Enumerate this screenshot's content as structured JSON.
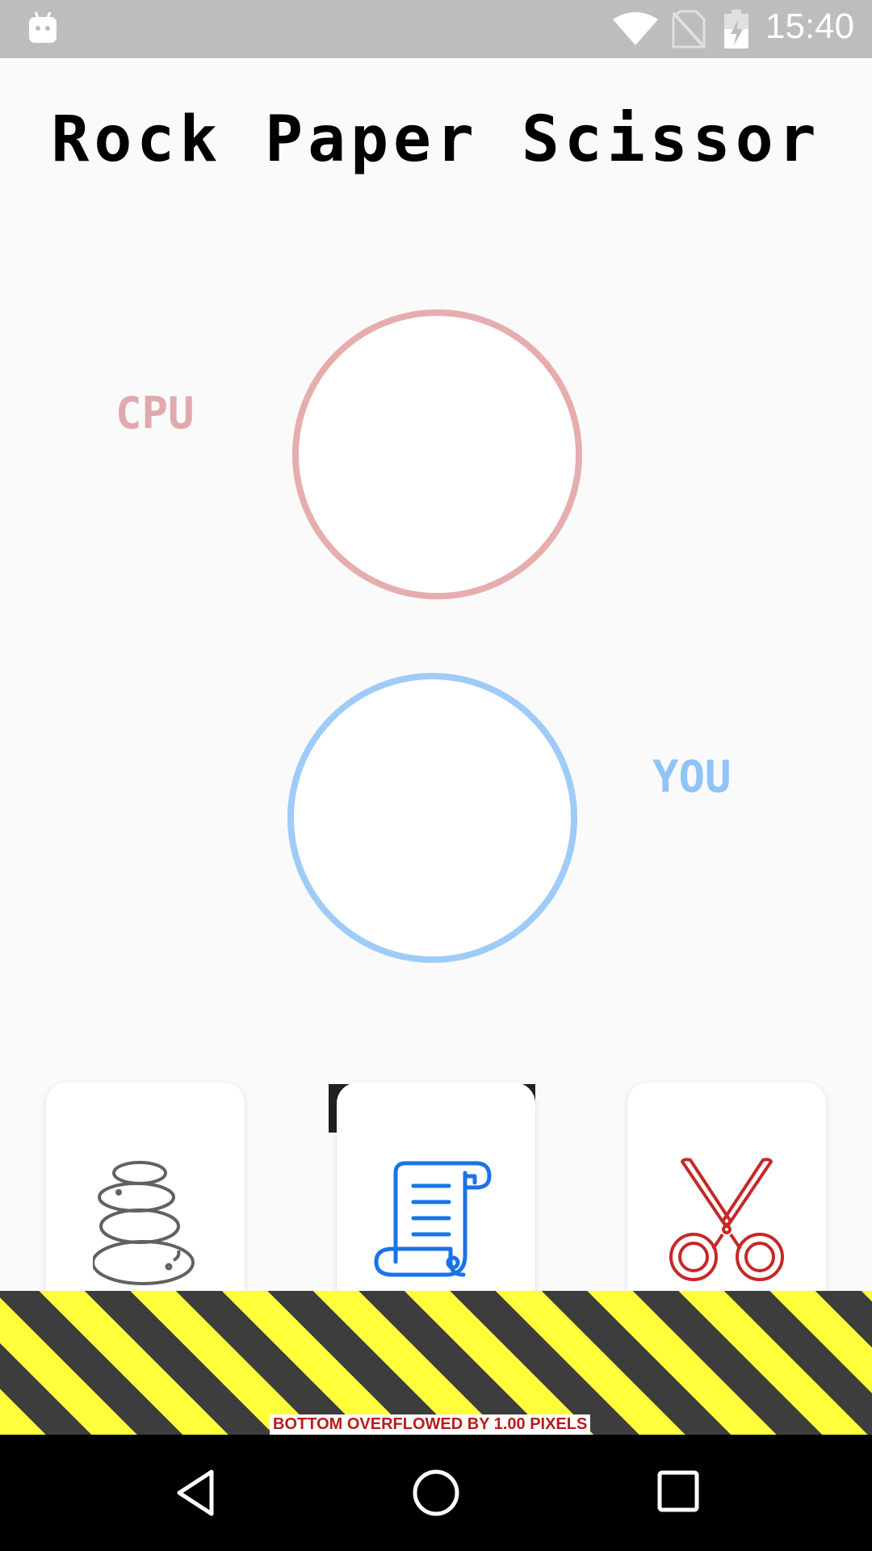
{
  "status_bar": {
    "time": "15:40",
    "icons": [
      "android-icon",
      "wifi-icon",
      "no-sim-icon",
      "battery-charging-icon"
    ]
  },
  "title": "Rock Paper Scissor",
  "labels": {
    "cpu": "CPU",
    "you": "YOU"
  },
  "colors": {
    "cpu_accent": "#e6adaf",
    "you_accent": "#9fcbf8",
    "rock_icon": "#616161",
    "paper_icon": "#1a73e8",
    "scissor_icon": "#c62828"
  },
  "choices": [
    {
      "name": "rock",
      "icon": "stones-icon"
    },
    {
      "name": "paper",
      "icon": "scroll-icon"
    },
    {
      "name": "scissor",
      "icon": "scissors-icon"
    }
  ],
  "overflow_warning": "BOTTOM OVERFLOWED BY 1.00 PIXELS",
  "nav_bar": {
    "icons": [
      "back-icon",
      "home-icon",
      "recents-icon"
    ]
  }
}
